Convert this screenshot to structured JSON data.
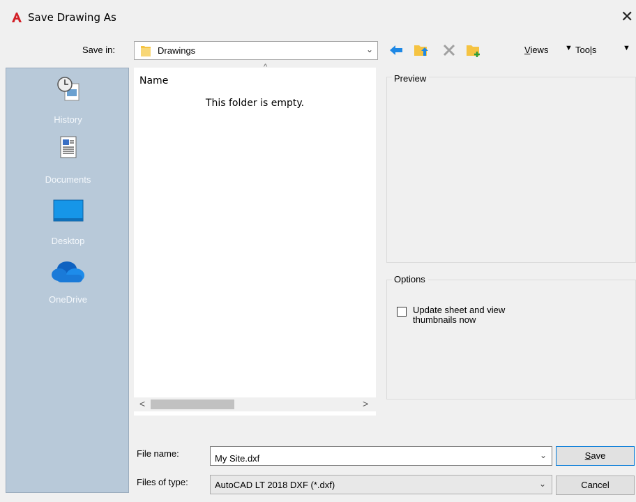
{
  "window": {
    "title": "Save Drawing As",
    "close_glyph": "✕"
  },
  "savein": {
    "label": "Save in:",
    "value": "Drawings",
    "chevron": "⌄"
  },
  "toolbar": {
    "icons": [
      "back-arrow-icon",
      "up-folder-icon",
      "delete-icon",
      "new-folder-icon"
    ],
    "views_prefix": "V",
    "views_rest": "iews",
    "tools_pre": "Too",
    "tools_u": "l",
    "tools_post": "s",
    "dropdown_arrow": "▼"
  },
  "places": [
    {
      "label": "History",
      "icon": "history-icon"
    },
    {
      "label": "Documents",
      "icon": "documents-icon"
    },
    {
      "label": "Desktop",
      "icon": "desktop-icon"
    },
    {
      "label": "OneDrive",
      "icon": "onedrive-icon"
    }
  ],
  "filelist": {
    "column_name": "Name",
    "sort_indicator": "^",
    "empty_message": "This folder is empty.",
    "scroll_left": "<",
    "scroll_right": ">"
  },
  "preview": {
    "label": "Preview"
  },
  "options": {
    "label": "Options",
    "update_thumbnails": "Update sheet and view thumbnails now",
    "checked": false
  },
  "filename": {
    "label": "File name:",
    "value": "My Site.dxf"
  },
  "filetype": {
    "label": "Files of type:",
    "value": "AutoCAD LT 2018 DXF (*.dxf)"
  },
  "buttons": {
    "save_prefix": "S",
    "save_rest": "ave",
    "cancel": "Cancel"
  },
  "colors": {
    "accent": "#0078d7",
    "places_bg": "#b8c9d9",
    "logo": "#d21f26",
    "folder": "#f5c342"
  }
}
